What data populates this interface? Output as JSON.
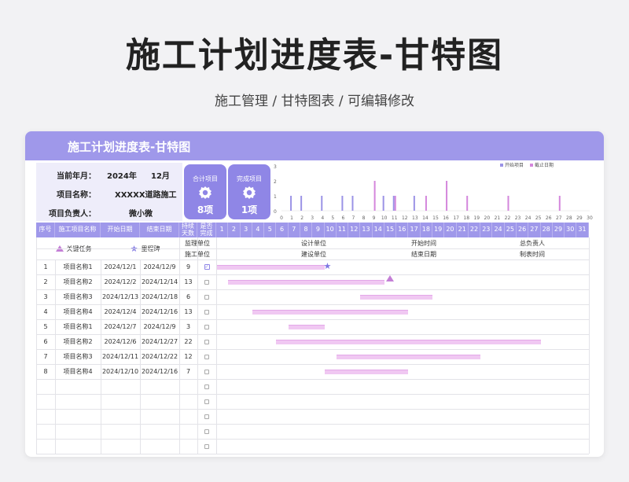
{
  "page": {
    "title": "施工计划进度表-甘特图",
    "subtitle": "施工管理 / 甘特图表 / 可编辑修改"
  },
  "card": {
    "title": "施工计划进度表-甘特图"
  },
  "info": {
    "month_label": "当前年月：",
    "year": "2024年",
    "month": "12月",
    "project_label": "项目名称：",
    "project_value": "XXXXX道路施工",
    "owner_label": "项目负责人：",
    "owner_value": "微小微"
  },
  "stats": {
    "total_label": "合计项目",
    "total_value": "8项",
    "done_label": "完成项目",
    "done_value": "1项"
  },
  "colors": {
    "header": "#9f98ea",
    "stat": "#8f86e6",
    "start_series": "#9b93e6",
    "end_series": "#d487dc",
    "bar": "#f0c8f2"
  },
  "chart_data": {
    "type": "bar",
    "categories": [
      "1",
      "2",
      "3",
      "4",
      "5",
      "6",
      "7",
      "8",
      "9",
      "10",
      "11",
      "12",
      "13",
      "14",
      "15",
      "16",
      "17",
      "18",
      "19",
      "20",
      "21",
      "22",
      "23",
      "24",
      "25",
      "26",
      "27",
      "28",
      "29",
      "30",
      "31"
    ],
    "series": [
      {
        "name": "开始项目",
        "values": [
          1,
          1,
          0,
          1,
          0,
          1,
          1,
          0,
          0,
          1,
          1,
          0,
          1,
          0,
          0,
          0,
          0,
          0,
          0,
          0,
          0,
          0,
          0,
          0,
          0,
          0,
          0,
          0,
          0,
          0,
          0
        ]
      },
      {
        "name": "截止日期",
        "values": [
          0,
          0,
          0,
          0,
          0,
          0,
          0,
          0,
          2,
          0,
          1,
          0,
          0,
          1,
          0,
          2,
          0,
          1,
          0,
          0,
          0,
          1,
          0,
          0,
          0,
          0,
          1,
          0,
          0,
          0,
          0
        ]
      }
    ],
    "ylim": [
      0,
      3
    ],
    "yticks": [
      "0",
      "1",
      "2",
      "3"
    ],
    "xticks": [
      "0",
      "1",
      "2",
      "3",
      "4",
      "5",
      "6",
      "7",
      "8",
      "9",
      "10",
      "11",
      "12",
      "13",
      "14",
      "15",
      "16",
      "17",
      "18",
      "19",
      "20",
      "21",
      "22",
      "23",
      "24",
      "25",
      "26",
      "27",
      "28",
      "29",
      "30"
    ],
    "legend": "top-right"
  },
  "table": {
    "headers": {
      "index": "序号",
      "name": "施工项目名称",
      "start": "开始日期",
      "end": "结束日期",
      "duration": "持续天数",
      "done": "是否完成"
    },
    "days": [
      "1",
      "2",
      "3",
      "4",
      "5",
      "6",
      "7",
      "8",
      "9",
      "10",
      "11",
      "12",
      "13",
      "14",
      "15",
      "16",
      "17",
      "18",
      "19",
      "20",
      "21",
      "22",
      "23",
      "24",
      "25",
      "26",
      "27",
      "28",
      "29",
      "30",
      "31"
    ],
    "legend": {
      "key_task": "关键任务",
      "milestone": "里程碑"
    },
    "meta": {
      "supervisor": "监理单位",
      "design": "设计单位",
      "start_time": "开始时间",
      "director": "总负责人",
      "construction": "施工单位",
      "builder": "建设单位",
      "end_date": "结束日期",
      "creator": "制表时间"
    },
    "rows": [
      {
        "index": "1",
        "name": "项目名称1",
        "start": "2024/12/1",
        "end": "2024/12/9",
        "duration": "9",
        "done": true,
        "startDay": 1,
        "endDay": 9,
        "marker": "star"
      },
      {
        "index": "2",
        "name": "项目名称2",
        "start": "2024/12/2",
        "end": "2024/12/14",
        "duration": "13",
        "done": false,
        "startDay": 2,
        "endDay": 14,
        "marker": "tri"
      },
      {
        "index": "3",
        "name": "项目名称3",
        "start": "2024/12/13",
        "end": "2024/12/18",
        "duration": "6",
        "done": false,
        "startDay": 13,
        "endDay": 18,
        "marker": ""
      },
      {
        "index": "4",
        "name": "项目名称4",
        "start": "2024/12/4",
        "end": "2024/12/16",
        "duration": "13",
        "done": false,
        "startDay": 4,
        "endDay": 16,
        "marker": ""
      },
      {
        "index": "5",
        "name": "项目名称1",
        "start": "2024/12/7",
        "end": "2024/12/9",
        "duration": "3",
        "done": false,
        "startDay": 7,
        "endDay": 9,
        "marker": ""
      },
      {
        "index": "6",
        "name": "项目名称2",
        "start": "2024/12/6",
        "end": "2024/12/27",
        "duration": "22",
        "done": false,
        "startDay": 6,
        "endDay": 27,
        "marker": ""
      },
      {
        "index": "7",
        "name": "项目名称3",
        "start": "2024/12/11",
        "end": "2024/12/22",
        "duration": "12",
        "done": false,
        "startDay": 11,
        "endDay": 22,
        "marker": ""
      },
      {
        "index": "8",
        "name": "项目名称4",
        "start": "2024/12/10",
        "end": "2024/12/16",
        "duration": "7",
        "done": false,
        "startDay": 10,
        "endDay": 16,
        "marker": ""
      }
    ],
    "empty_rows": 5
  }
}
